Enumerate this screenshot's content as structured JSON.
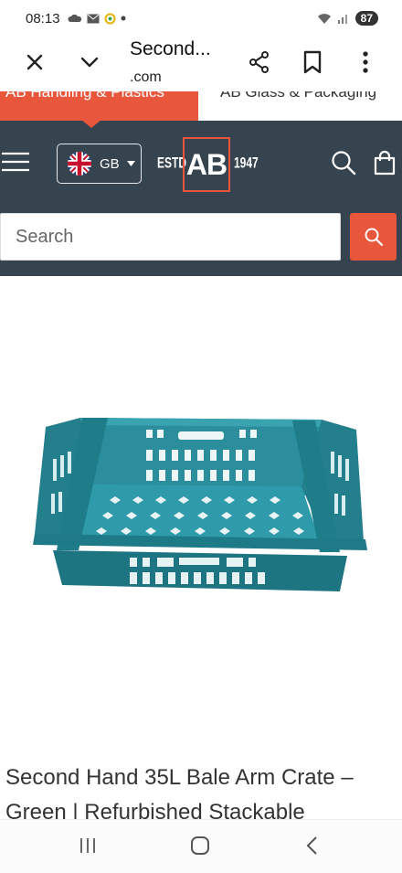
{
  "status_bar": {
    "time": "08:13",
    "battery": "87"
  },
  "browser": {
    "title": "Second...",
    "url": ".com"
  },
  "tabs": {
    "handling": "AB Handling & Plastics",
    "glass": "AB Glass & Packaging"
  },
  "header": {
    "locale": "GB",
    "logo": {
      "est": "ESTD",
      "mark": "AB",
      "year": "1947"
    },
    "search_placeholder": "Search"
  },
  "product": {
    "title": "Second Hand 35L Bale Arm Crate – Green | Refurbished Stackable",
    "crate_color": "#2a8f9c"
  },
  "colors": {
    "accent": "#e8563b",
    "header_bg": "#36444f"
  }
}
